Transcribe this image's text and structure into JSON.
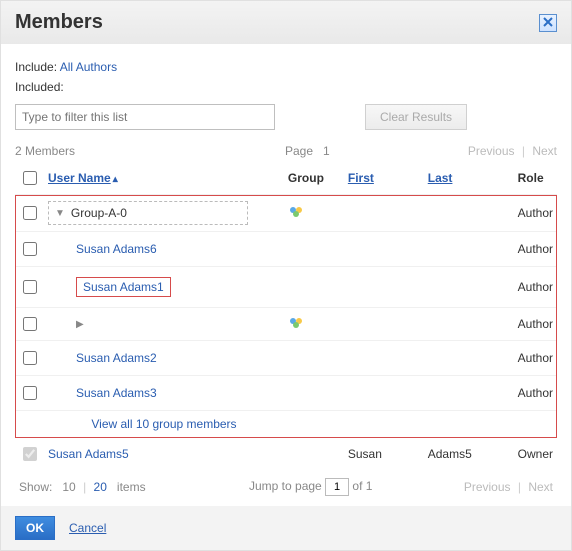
{
  "dialog": {
    "title": "Members"
  },
  "include": {
    "label": "Include:",
    "value": "All Authors"
  },
  "included": {
    "label": "Included:"
  },
  "filter": {
    "placeholder": "Type to filter this list",
    "clear_label": "Clear Results"
  },
  "meta": {
    "count_text": "2 Members",
    "page_label": "Page",
    "page_value": "1",
    "prev": "Previous",
    "next": "Next"
  },
  "columns": {
    "user_name": "User Name",
    "group": "Group",
    "first": "First",
    "last": "Last",
    "role": "Role"
  },
  "rows": {
    "group_a0": {
      "name": "Group-A-0",
      "role": "Author"
    },
    "susan6": {
      "name": "Susan Adams6",
      "role": "Author"
    },
    "susan1": {
      "name": "Susan Adams1",
      "role": "Author"
    },
    "collapsed": {
      "role": "Author"
    },
    "susan2": {
      "name": "Susan Adams2",
      "role": "Author"
    },
    "susan3": {
      "name": "Susan Adams3",
      "role": "Author"
    },
    "view_all": "View all 10 group members",
    "owner": {
      "name": "Susan Adams5",
      "first": "Susan",
      "last": "Adams5",
      "role": "Owner"
    }
  },
  "footer": {
    "show_label": "Show:",
    "opt10": "10",
    "opt20": "20",
    "items": "items",
    "jump_label": "Jump to page",
    "jump_value": "1",
    "of_text": "of 1",
    "prev": "Previous",
    "next": "Next"
  },
  "buttons": {
    "ok": "OK",
    "cancel": "Cancel"
  }
}
